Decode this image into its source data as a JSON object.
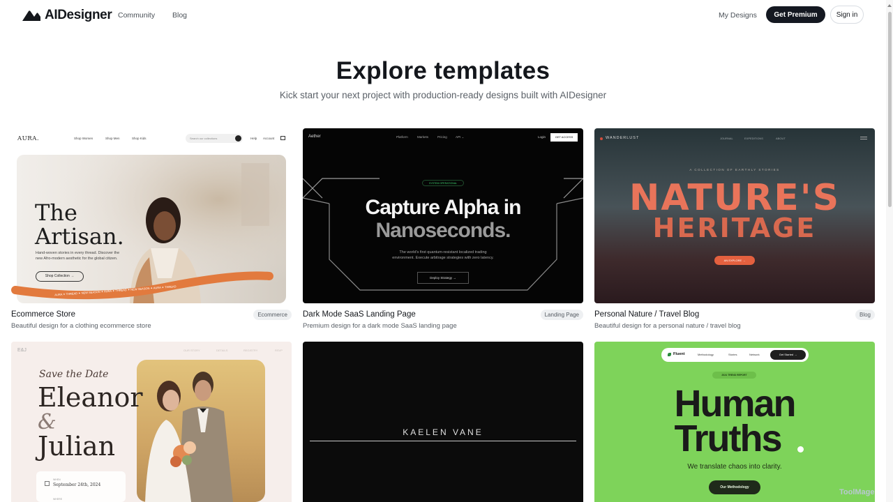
{
  "nav": {
    "brand": "AIDesigner",
    "links": [
      "Community",
      "Blog"
    ],
    "my_designs": "My Designs",
    "premium": "Get Premium",
    "signin": "Sign in"
  },
  "hero": {
    "title": "Explore templates",
    "subtitle": "Kick start your next project with production-ready designs built with AIDesigner"
  },
  "cards": [
    {
      "title": "Ecommerce Store",
      "desc": "Beautiful design for a clothing ecommerce store",
      "tag": "Ecommerce",
      "preview": {
        "brand": "AURA.",
        "links": [
          "Shop Women",
          "Shop Men",
          "Shop Kids"
        ],
        "search": "Search our collections",
        "help": "Help",
        "account": "Account",
        "headline1": "The",
        "headline2": "Artisan.",
        "body1": "Hand-woven stories in every thread. Discover the",
        "body2": "new Afro-modern aesthetic for the global citizen.",
        "cta": "Shop Collection →",
        "ribbon": "AURA ✦ THREAD ✦ NEW SEASON ✦ AURA ✦ THREAD ✦ NEW SEASON ✦ AURA ✦ THREAD"
      }
    },
    {
      "title": "Dark Mode SaaS Landing Page",
      "desc": "Premium design for a dark mode SaaS landing page",
      "tag": "Landing Page",
      "preview": {
        "brand": "Aether",
        "links": [
          "Platform",
          "Markets",
          "Pricing",
          "API ⌄"
        ],
        "login": "Login",
        "access": "GET ACCESS",
        "status": "SYSTEM OPERATIONAL",
        "headline1": "Capture Alpha in",
        "headline2": "Nanoseconds.",
        "body1": "The world's first quantum-resistant localized trading",
        "body2": "environment. Execute arbitrage strategies with zero latency.",
        "cta": "Deploy Strategy →"
      }
    },
    {
      "title": "Personal Nature / Travel Blog",
      "desc": "Beautiful design for a personal nature / travel blog",
      "tag": "Blog",
      "preview": {
        "brand": "WANDERLUST",
        "links": [
          "JOURNAL",
          "EXPEDITIONS",
          "ABOUT"
        ],
        "kicker": "A COLLECTION OF EARTHLY STORIES",
        "headline1": "NATURE'S",
        "headline2": "HERITAGE",
        "cta": "AN EXPLORE →"
      }
    },
    {
      "preview": {
        "brand": "E&J",
        "links": [
          "OUR STORY",
          "DETAILS",
          "REGISTRY",
          "RSVP"
        ],
        "script": "Save the Date",
        "name1": "Eleanor",
        "amp": "&",
        "name2": "Julian",
        "when_label": "WHEN",
        "when_value": "September 24th, 2024",
        "where_label": "WHERE"
      }
    },
    {
      "preview": {
        "name": "KAELEN VANE"
      }
    },
    {
      "preview": {
        "brand": "Fluent",
        "links": [
          "Methodology",
          "Stories",
          "Network"
        ],
        "cta_nav": "Get Started →",
        "badge": "2024 TREND REPORT",
        "headline1": "Human",
        "headline2": "Truths",
        "sub": "We translate chaos into clarity.",
        "cta": "Our Methodology"
      }
    }
  ],
  "watermark": "ToolMage"
}
